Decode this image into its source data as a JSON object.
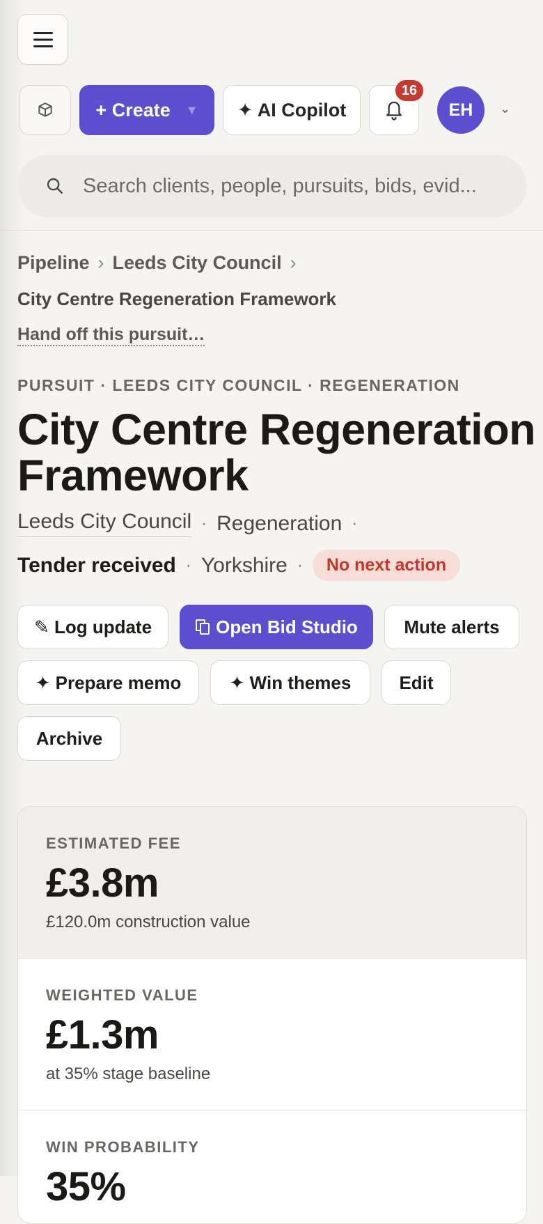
{
  "topbar": {
    "menu_icon": "hamburger-icon",
    "box_icon": "cube-icon",
    "create_label": "+ Create",
    "copilot_label": "✦ AI Copilot",
    "notification_count": "16",
    "avatar_initials": "EH",
    "accent_color": "#5b4fd0",
    "badge_color": "#c53a2e"
  },
  "search": {
    "placeholder": "Search clients, people, pursuits, bids, evid..."
  },
  "breadcrumb": {
    "items": [
      "Pipeline",
      "Leeds City Council"
    ],
    "separator": "›",
    "current": "City Centre Regeneration Framework"
  },
  "handoff_link": "Hand off this pursuit…",
  "header": {
    "eyebrow": "PURSUIT · LEEDS CITY COUNCIL · REGENERATION",
    "title": "City Centre Regeneration Framework",
    "client": "Leeds City Council",
    "sector": "Regeneration",
    "stage": "Tender received",
    "region": "Yorkshire",
    "next_action": "No next action",
    "dot": "·"
  },
  "actions": {
    "log_update": "✎ Log update",
    "open_bid_studio": "Open Bid Studio",
    "mute_alerts": "Mute alerts",
    "prepare_memo": "✦ Prepare memo",
    "win_themes": "✦ Win themes",
    "edit": "Edit",
    "archive": "Archive"
  },
  "stats": [
    {
      "label": "ESTIMATED FEE",
      "value": "£3.8m",
      "sub": "£120.0m construction value"
    },
    {
      "label": "WEIGHTED VALUE",
      "value": "£1.3m",
      "sub": "at 35% stage baseline"
    },
    {
      "label": "WIN PROBABILITY",
      "value": "35%",
      "sub": ""
    }
  ]
}
